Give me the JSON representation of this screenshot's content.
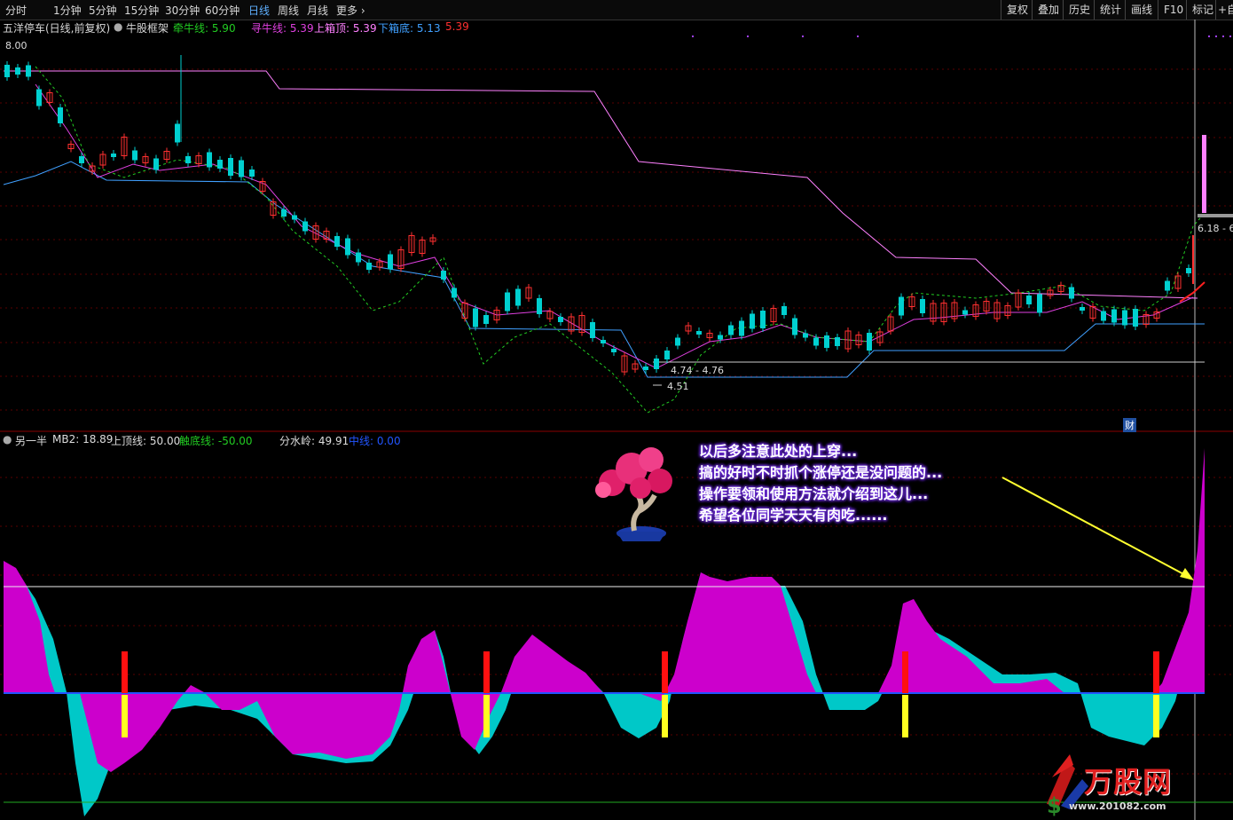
{
  "toolbar": {
    "periods": [
      "分时",
      "1分钟",
      "5分钟",
      "15分钟",
      "30分钟",
      "60分钟",
      "日线",
      "周线",
      "月线",
      "更多 ›"
    ],
    "active_period": "日线",
    "right_buttons": [
      "复权",
      "叠加",
      "历史",
      "统计",
      "画线",
      "F10",
      "标记",
      "+自"
    ]
  },
  "main_panel": {
    "stock_title": "五洋停车(日线,前复权)",
    "indicator_name": "牛股框架",
    "legend": [
      {
        "label": "牵牛线: 5.90",
        "color": "#22cc22"
      },
      {
        "label": "寻牛线: 5.39",
        "color": "#e040e0"
      },
      {
        "label": "上箱顶: 5.39",
        "color": "#ff80ff"
      },
      {
        "label": "下箱底: 5.13",
        "color": "#40a0ff"
      },
      {
        "label": "5.39",
        "color": "#ff3030"
      }
    ],
    "price_labels": {
      "high_start": "8.00",
      "low_range": "4.74 - 4.76",
      "low": "4.51",
      "current_range": "6.18 - 6",
      "marker_cai": "财"
    }
  },
  "sub_panel": {
    "indicator_name": "另一半",
    "legend": [
      {
        "label": "MB2: 18.89",
        "color": "#dddddd"
      },
      {
        "label": "上顶线: 50.00",
        "color": "#dddddd"
      },
      {
        "label": "触底线: -50.00",
        "color": "#22cc22"
      },
      {
        "label": "分水岭: 49.91",
        "color": "#dddddd"
      },
      {
        "label": "中线: 0.00",
        "color": "#2255ff"
      }
    ]
  },
  "annotation": {
    "lines": [
      "以后多注意此处的上穿...",
      "搞的好时不时抓个涨停还是没问题的...",
      "操作要领和使用方法就介绍到这儿...",
      "希望各位同学天天有肉吃......"
    ]
  },
  "watermark": {
    "brand": "万股网",
    "url": "www.201082.com"
  },
  "colors": {
    "up_candle": "#ff3030",
    "down_candle": "#00d0d0",
    "magenta_area": "#cc00cc",
    "cyan_area": "#00c8c8"
  }
}
